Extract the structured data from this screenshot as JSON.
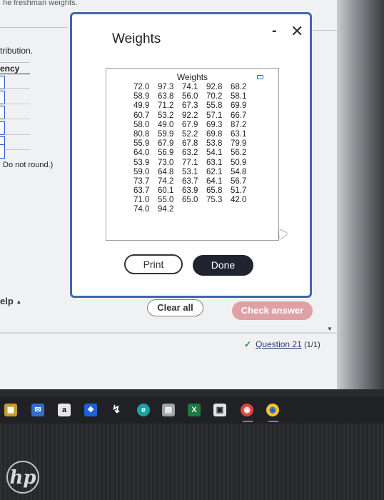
{
  "background": {
    "top_text": "he freshman weights.",
    "distribution_label": "tribution.",
    "frequency_label": "ency",
    "note": "Do not round.)",
    "help_label": "elp",
    "clear_all": "Clear all",
    "check_answer": "Check answer",
    "question_link": "Question 21",
    "question_score": "(1/1)"
  },
  "modal": {
    "title": "Weights",
    "minimize_glyph": "-",
    "close_glyph": "✕",
    "table_header": "Weights",
    "rows": [
      [
        "72.0",
        "97.3",
        "74.1",
        "92.8",
        "68.2"
      ],
      [
        "58.9",
        "63.8",
        "56.0",
        "70.2",
        "58.1"
      ],
      [
        "49.9",
        "71.2",
        "67.3",
        "55.8",
        "69.9"
      ],
      [
        "60.7",
        "53.2",
        "92.2",
        "57.1",
        "66.7"
      ],
      [
        "58.0",
        "49.0",
        "67.9",
        "69.3",
        "87.2"
      ],
      [
        "80.8",
        "59.9",
        "52.2",
        "69.8",
        "63.1"
      ],
      [
        "55.9",
        "67.9",
        "67.8",
        "53.8",
        "79.9"
      ],
      [
        "64.0",
        "56.9",
        "63.2",
        "54.1",
        "56.2"
      ],
      [
        "53.9",
        "73.0",
        "77.1",
        "63.1",
        "50.9"
      ],
      [
        "59.0",
        "64.8",
        "53.1",
        "62.1",
        "54.8"
      ],
      [
        "73.7",
        "74.2",
        "63.7",
        "64.1",
        "56.7"
      ],
      [
        "63.7",
        "60.1",
        "63.9",
        "65.8",
        "51.7"
      ],
      [
        "71.0",
        "55.0",
        "65.0",
        "75.3",
        "42.0"
      ],
      [
        "74.0",
        "94.2"
      ]
    ],
    "print_label": "Print",
    "done_label": "Done"
  },
  "taskbar": {
    "icons": [
      "windows-store-icon",
      "mail-icon",
      "amazon-icon",
      "dropbox-icon",
      "stocks-icon",
      "edge-icon",
      "scanner-icon",
      "excel-icon",
      "teams-icon",
      "chrome-icon",
      "chrome-icon-2"
    ]
  },
  "colors": {
    "modal_border": "#3e67b0",
    "done_button": "#1f2430",
    "check_answer_button": "#e0a1a4",
    "link": "#2a3e7a"
  }
}
